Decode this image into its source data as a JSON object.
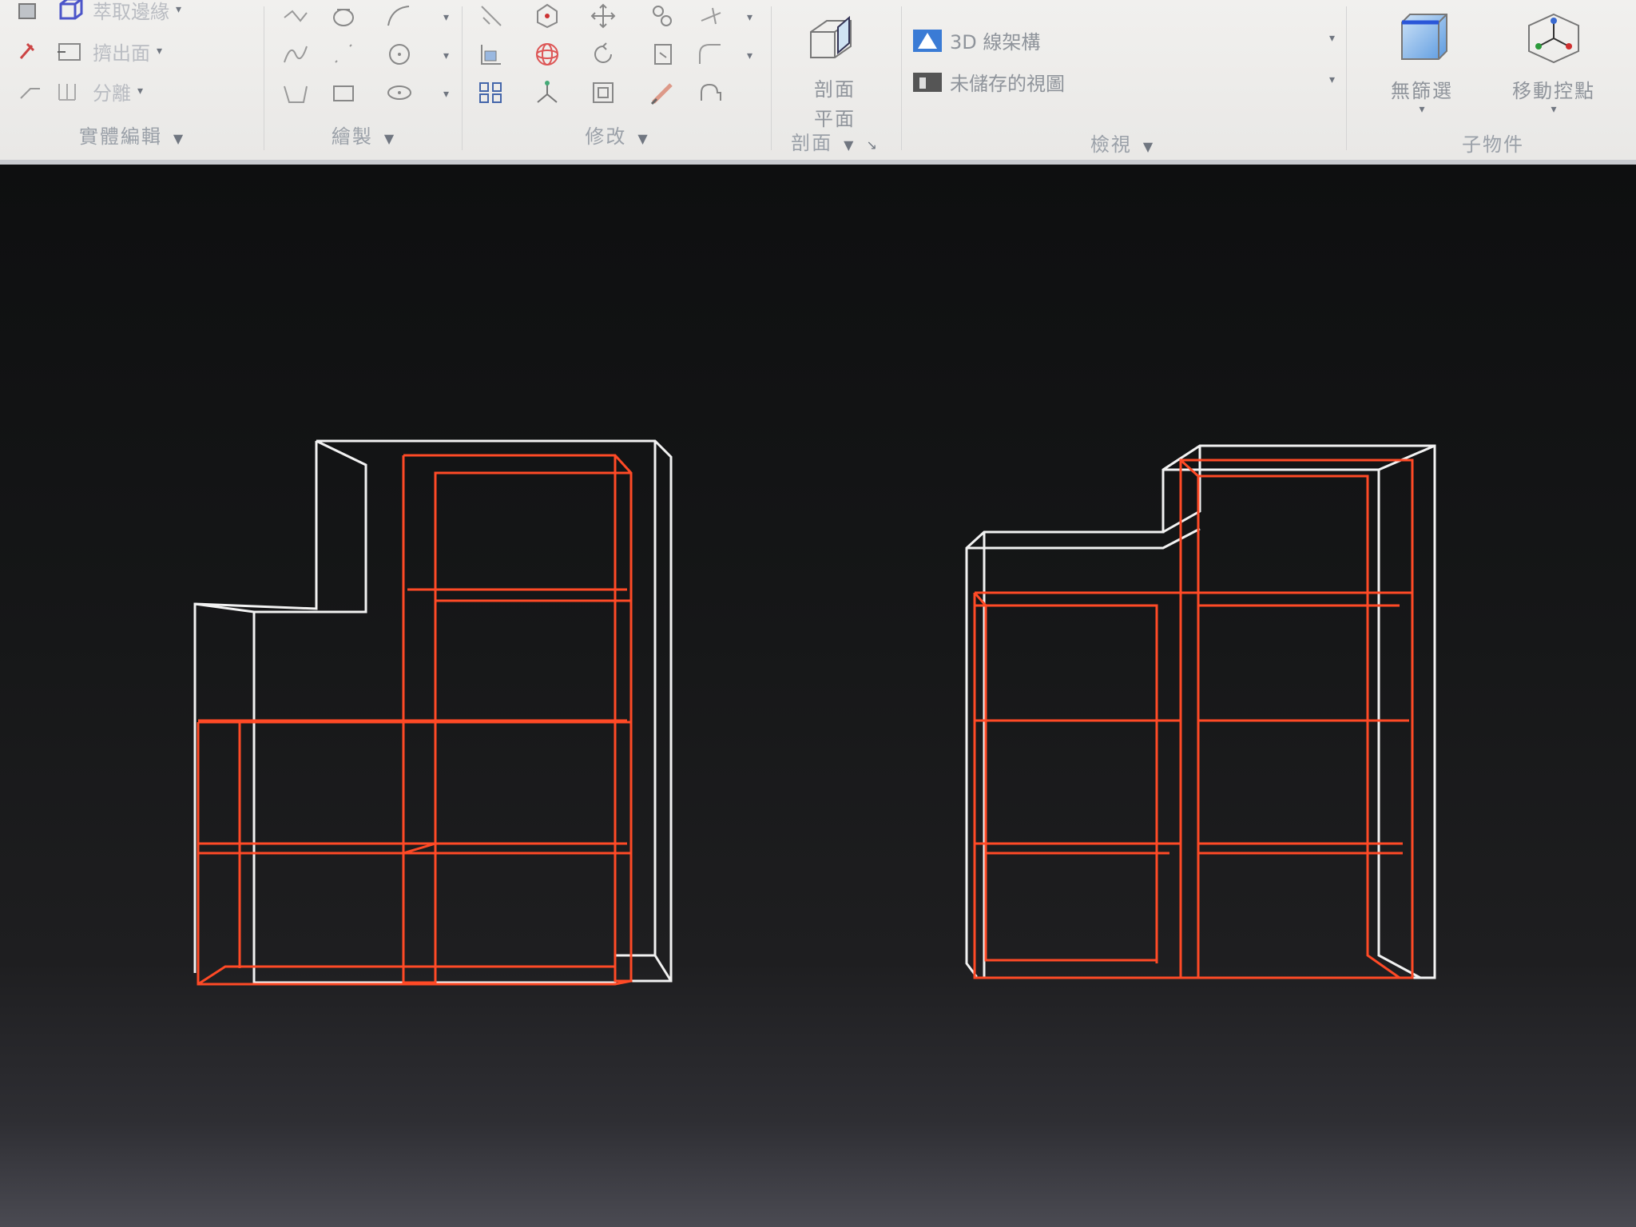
{
  "ribbon": {
    "solid_edit": {
      "label": "實體編輯",
      "tools": [
        "萃取邊緣",
        "擠出面",
        "分離"
      ]
    },
    "draw": {
      "label": "繪製"
    },
    "modify": {
      "label": "修改"
    },
    "section": {
      "label": "剖面",
      "plane_label_line1": "剖面",
      "plane_label_line2": "平面"
    },
    "view": {
      "label": "檢視",
      "visual_style": "3D 線架構",
      "saved_view": "未儲存的視圖"
    },
    "selection": {
      "label": "子物件",
      "no_filter": "無篩選",
      "move_gizmo": "移動控點"
    }
  },
  "colors": {
    "wire_white": "#f2f2f2",
    "wire_red": "#ff4a26",
    "ribbon_bg": "#eeedeb",
    "viewport_bg": "#141516"
  },
  "icons": [
    "extract-edges-icon",
    "extrude-face-icon",
    "separate-icon",
    "polyline-icon",
    "spline-icon",
    "rectangle-icon",
    "circle-icon",
    "ellipse-icon",
    "move-icon",
    "rotate-icon",
    "scale-icon",
    "mirror-icon",
    "array-icon",
    "fillet-icon",
    "section-plane-icon",
    "visual-style-icon",
    "named-view-icon",
    "no-filter-icon",
    "move-gizmo-icon"
  ]
}
